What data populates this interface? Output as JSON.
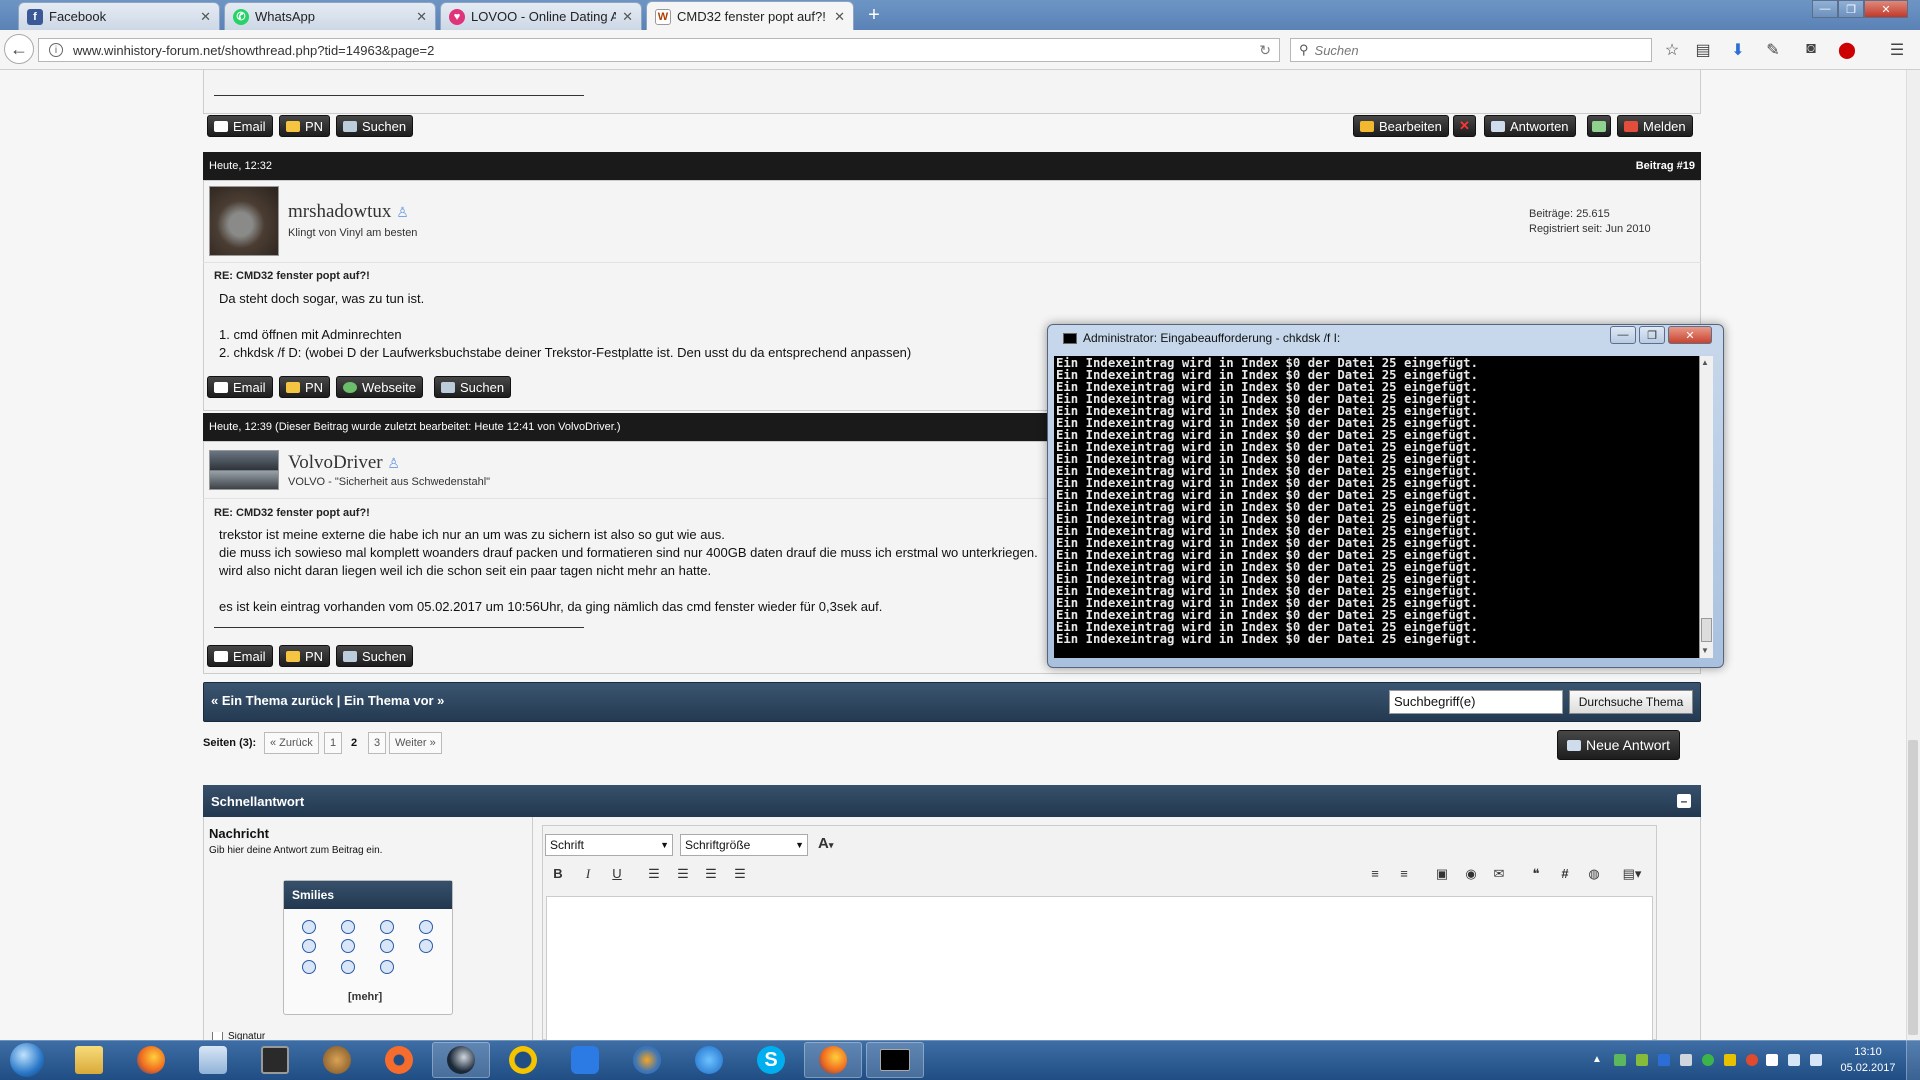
{
  "browser": {
    "tabs": [
      {
        "label": "Facebook",
        "icon": "facebook-icon"
      },
      {
        "label": "WhatsApp",
        "icon": "whatsapp-icon"
      },
      {
        "label": "LOVOO - Online Dating Ap...",
        "icon": "lovoo-icon"
      },
      {
        "label": "CMD32 fenster popt auf?!",
        "icon": "winhistory-icon",
        "active": true
      }
    ],
    "url": "www.winhistory-forum.net/showthread.php?tid=14963&page=2",
    "search_placeholder": "Suchen"
  },
  "post18_buttons": {
    "email": "Email",
    "pn": "PN",
    "search": "Suchen",
    "edit": "Bearbeiten",
    "reply": "Antworten",
    "report": "Melden"
  },
  "post19": {
    "date": "Heute, 12:32",
    "number": "Beitrag #19",
    "username": "mrshadowtux",
    "usertitle": "Klingt von Vinyl am besten",
    "stats_posts": "Beiträge: 25.615",
    "stats_registered": "Registriert seit: Jun 2010",
    "title": "RE: CMD32 fenster popt auf?!",
    "lines": [
      "Da steht doch sogar, was zu tun ist.",
      "",
      "1. cmd öffnen mit Adminrechten",
      "2. chkdsk /f D: (wobei D der Laufwerksbuchstabe deiner Trekstor-Festplatte ist. Den usst du da entsprechend anpassen)"
    ],
    "buttons": {
      "email": "Email",
      "pn": "PN",
      "website": "Webseite",
      "search": "Suchen"
    }
  },
  "post20": {
    "date": "Heute, 12:39 (Dieser Beitrag wurde zuletzt bearbeitet: Heute 12:41 von VolvoDriver.)",
    "username": "VolvoDriver",
    "usertitle": "VOLVO - \"Sicherheit aus Schwedenstahl\"",
    "title": "RE: CMD32 fenster popt auf?!",
    "lines": [
      "trekstor ist meine externe die habe ich nur an um was zu sichern ist also so gut wie aus.",
      "die muss ich sowieso mal komplett woanders drauf packen und formatieren sind nur 400GB daten drauf die muss ich erstmal wo unterkriegen.",
      "wird also nicht daran liegen weil ich die schon seit ein paar tagen nicht mehr an hatte.",
      "",
      "es ist kein eintrag vorhanden vom 05.02.2017 um 10:56Uhr, da ging nämlich das cmd fenster wieder für 0,3sek auf."
    ],
    "buttons": {
      "email": "Email",
      "pn": "PN",
      "search": "Suchen"
    }
  },
  "cmd": {
    "title": "Administrator: Eingabeaufforderung - chkdsk  /f I:",
    "line": "Ein Indexeintrag wird in Index $0 der Datei 25 eingefügt.",
    "line_count": 24
  },
  "threadnav": {
    "prev": "« Ein Thema zurück",
    "sep": "|",
    "next": "Ein Thema vor »",
    "search_value": "Suchbegriff(e)",
    "search_button": "Durchsuche Thema"
  },
  "pagination": {
    "label": "Seiten (3):",
    "prev": "« Zurück",
    "pages": [
      "1",
      "2",
      "3"
    ],
    "current": "2",
    "next": "Weiter »",
    "new_reply": "Neue Antwort"
  },
  "quickreply": {
    "title": "Schnellantwort",
    "collapse": "–",
    "message_label": "Nachricht",
    "message_hint": "Gib hier deine Antwort zum Beitrag ein.",
    "font_select": "Schrift",
    "size_select": "Schriftgröße",
    "smilies_title": "Smilies",
    "smilies_more": "[mehr]",
    "signature_label": "Signatur"
  },
  "taskbar": {
    "time": "13:10",
    "date": "05.02.2017"
  },
  "colors": {
    "forum_dark": "#1a1a1a",
    "forum_blue": "#2c4560",
    "taskbar": "#2a5a92"
  }
}
